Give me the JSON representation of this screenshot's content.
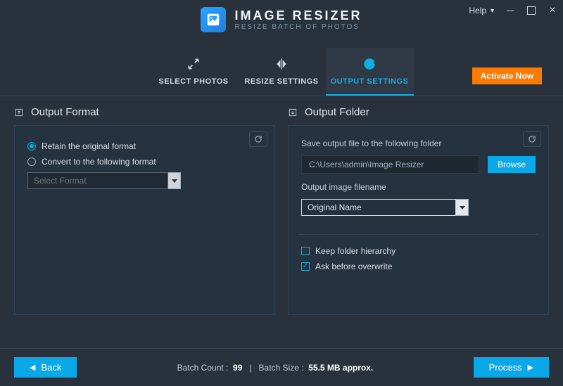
{
  "titlebar": {
    "help": "Help"
  },
  "brand": {
    "title": "IMAGE RESIZER",
    "subtitle": "RESIZE BATCH OF PHOTOS"
  },
  "tabs": {
    "select": "SELECT PHOTOS",
    "resize": "RESIZE SETTINGS",
    "output": "OUTPUT SETTINGS"
  },
  "activate": "Activate Now",
  "format": {
    "heading": "Output Format",
    "retain": "Retain the original format",
    "convert": "Convert to the following format",
    "select_placeholder": "Select Format"
  },
  "folder": {
    "heading": "Output Folder",
    "save_label": "Save output file to the following folder",
    "path": "C:\\Users\\admin\\Image Resizer",
    "browse": "Browse",
    "filename_label": "Output image filename",
    "filename_value": "Original Name",
    "keep_hierarchy": "Keep folder hierarchy",
    "ask_overwrite": "Ask before overwrite"
  },
  "footer": {
    "back": "Back",
    "count_label": "Batch Count :",
    "count_value": "99",
    "size_label": "Batch Size :",
    "size_value": "55.5 MB approx.",
    "process": "Process"
  }
}
